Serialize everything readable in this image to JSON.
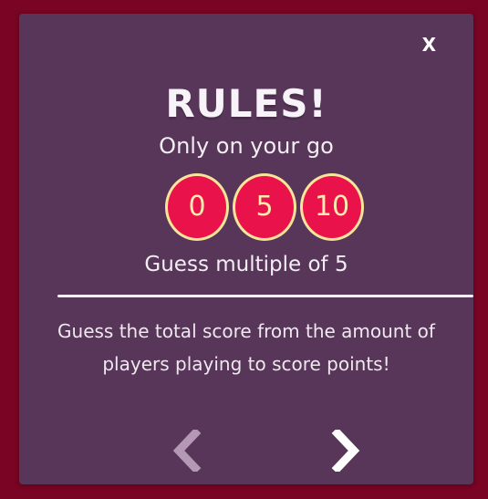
{
  "close_label": "X",
  "title": "RULES!",
  "subtitle": "Only on your go",
  "chips": [
    "0",
    "5",
    "10"
  ],
  "hint": "Guess multiple of 5",
  "description": "Guess the total score from the amount of players playing to score points!",
  "nav": {
    "prev_icon": "chevron-left-icon",
    "next_icon": "chevron-right-icon",
    "prev_enabled": false,
    "next_enabled": true
  },
  "colors": {
    "background": "#7a0424",
    "panel": "#583659",
    "chip_fill": "#e9124a",
    "chip_border": "#f6e59a",
    "chip_text": "#fbe9b0",
    "text": "#f2eef3",
    "arrow_disabled": "#b597b6",
    "arrow_enabled": "#ffffff"
  }
}
